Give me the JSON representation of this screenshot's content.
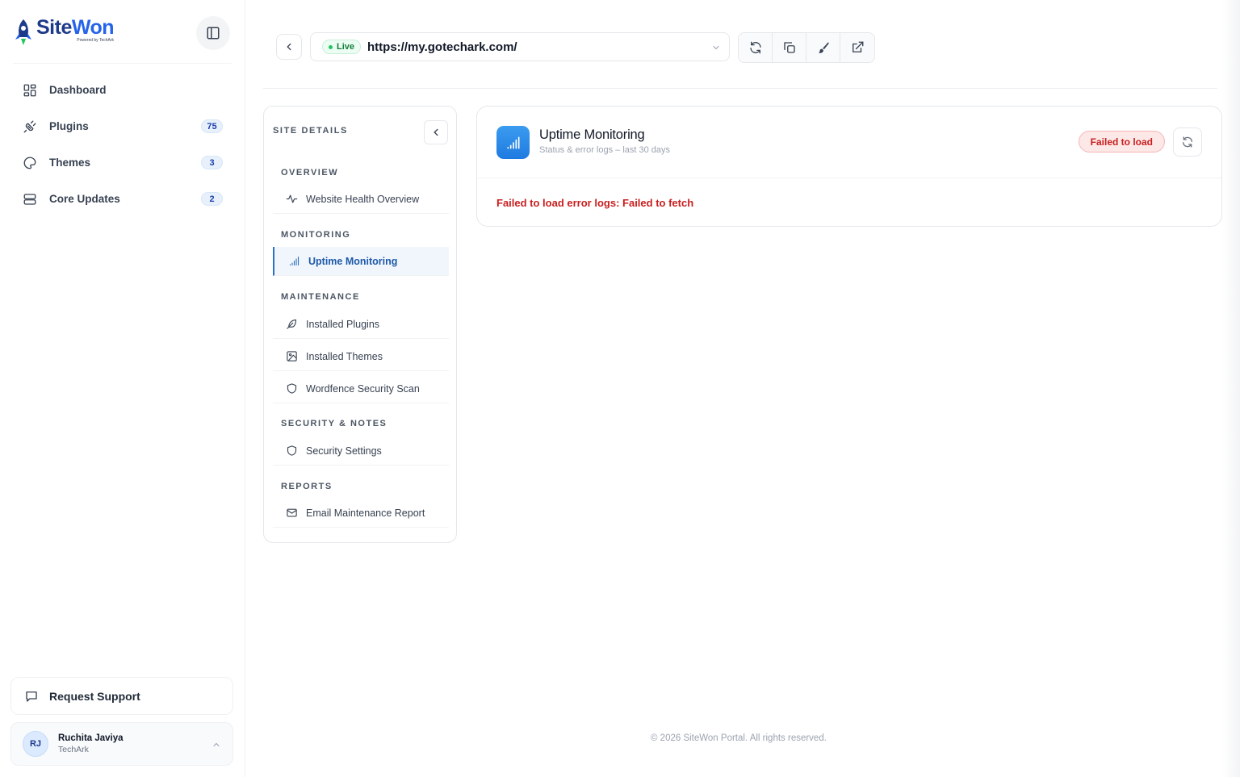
{
  "brand": {
    "name_part1": "Site",
    "name_part2": "Won",
    "tagline": "Powered by TechArk"
  },
  "sidebar": {
    "items": [
      {
        "label": "Dashboard",
        "icon": "dashboard-icon",
        "badge": ""
      },
      {
        "label": "Plugins",
        "icon": "plug-icon",
        "badge": "75"
      },
      {
        "label": "Themes",
        "icon": "palette-icon",
        "badge": "3"
      },
      {
        "label": "Core Updates",
        "icon": "server-icon",
        "badge": "2"
      }
    ],
    "support_label": "Request Support",
    "user": {
      "initials": "RJ",
      "name": "Ruchita Javiya",
      "org": "TechArk"
    }
  },
  "topbar": {
    "status": "Live",
    "url": "https://my.gotechark.com/",
    "tools": [
      "refresh-icon",
      "copy-icon",
      "brush-icon",
      "external-link-icon"
    ]
  },
  "details": {
    "title": "SITE DETAILS",
    "sections": {
      "overview": {
        "label": "OVERVIEW",
        "items": [
          "Website Health Overview"
        ]
      },
      "monitoring": {
        "label": "MONITORING",
        "items": [
          "Uptime Monitoring"
        ]
      },
      "maintenance": {
        "label": "MAINTENANCE",
        "items": [
          "Installed Plugins",
          "Installed Themes",
          "Wordfence Security Scan"
        ]
      },
      "security": {
        "label": "SECURITY & NOTES",
        "items": [
          "Security Settings"
        ]
      },
      "reports": {
        "label": "REPORTS",
        "items": [
          "Email Maintenance Report"
        ]
      }
    },
    "active_item": "Uptime Monitoring"
  },
  "card": {
    "title": "Uptime Monitoring",
    "subtitle": "Status & error logs – last 30 days",
    "status_badge": "Failed to load",
    "error_message": "Failed to load error logs: Failed to fetch"
  },
  "footer": {
    "text": "© 2026 SiteWon Portal. All rights reserved."
  },
  "colors": {
    "accent": "#2f6fc1",
    "error": "#c81e1e",
    "live": "#22c55e"
  }
}
